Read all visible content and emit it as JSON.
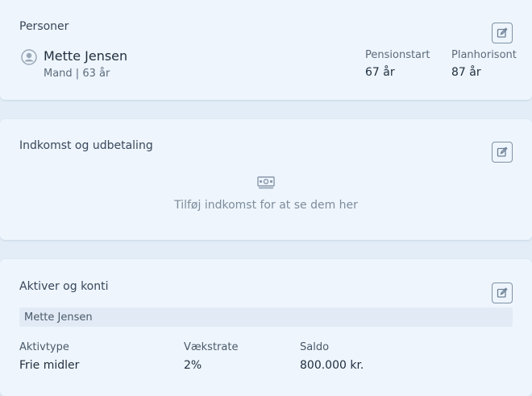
{
  "persons": {
    "title": "Personer",
    "person": {
      "name": "Mette Jensen",
      "meta": "Mand | 63 år"
    },
    "stats": [
      {
        "label": "Pensionstart",
        "value": "67 år"
      },
      {
        "label": "Planhorisont",
        "value": "87 år"
      }
    ]
  },
  "income": {
    "title": "Indkomst og udbetaling",
    "empty_text": "Tilføj indkomst for at se dem her"
  },
  "assets": {
    "title": "Aktiver og konti",
    "owner": "Mette Jensen",
    "columns": [
      "Aktivtype",
      "Vækstrate",
      "Saldo"
    ],
    "rows": [
      [
        "Frie midler",
        "2%",
        "800.000 kr."
      ]
    ]
  },
  "colors": {
    "background": "#e3edf7",
    "card": "#eef5fc",
    "icon": "#7f91a6"
  },
  "icons": {
    "edit": "edit-icon",
    "avatar": "user-circle-icon",
    "money": "money-icon"
  }
}
